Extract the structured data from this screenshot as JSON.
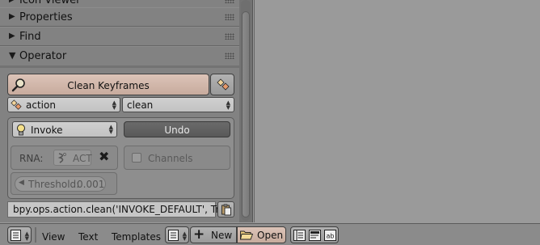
{
  "panels": {
    "icon_viewer": "Icon Viewer",
    "properties": "Properties",
    "find": "Find",
    "operator": "Operator"
  },
  "operator": {
    "main_button": "Clean Keyframes",
    "type_value": "action",
    "op_value": "clean",
    "invoke_value": "Invoke",
    "undo_label": "Undo",
    "rna_label": "RNA:",
    "rna_value": "ACT",
    "channels_label": "Channels",
    "threshold_label": "Threshold:",
    "threshold_value": "0.001",
    "console_text": "bpy.ops.action.clean('INVOKE_DEFAULT', True)"
  },
  "footer": {
    "view": "View",
    "text": "Text",
    "templates": "Templates",
    "new_label": "New",
    "open_label": "Open"
  },
  "colors": {
    "panel_bg": "#828282",
    "highlight_button": "#c7ab9d",
    "viewport_bg": "#9a9a9a"
  }
}
